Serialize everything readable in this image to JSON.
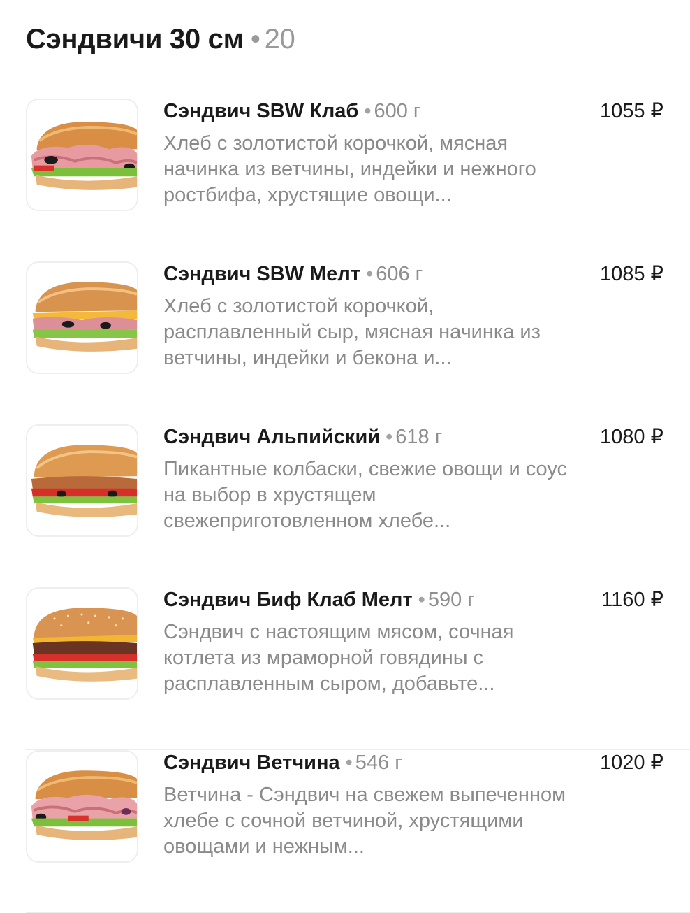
{
  "section": {
    "title": "Сэндвичи 30 см",
    "count": "20"
  },
  "separator": "•",
  "items": [
    {
      "name": "Сэндвич SBW Клаб",
      "weight": "600 г",
      "price": "1055 ₽",
      "description": "Хлеб с золотистой корочкой, мясная начинка из ветчины, индейки и нежного ростбифа, хрустящие овощи...",
      "image": "sandwich-club-image"
    },
    {
      "name": "Сэндвич SBW Мелт",
      "weight": "606 г",
      "price": "1085 ₽",
      "description": "Хлеб с золотистой корочкой, расплавленный сыр, мясная начинка из ветчины, индейки и бекона и...",
      "image": "sandwich-melt-image"
    },
    {
      "name": "Сэндвич Альпийский",
      "weight": "618 г",
      "price": "1080 ₽",
      "description": "Пикантные колбаски, свежие овощи и соус на выбор в хрустящем свежеприготовленном хлебе...",
      "image": "sandwich-alpine-image"
    },
    {
      "name": "Сэндвич Биф Клаб Мелт",
      "weight": "590 г",
      "price": "1160 ₽",
      "description": "Сэндвич с настоящим мясом, сочная котлета из мраморной говядины с расплавленным сыром, добавьте...",
      "image": "sandwich-beef-image"
    },
    {
      "name": "Сэндвич Ветчина",
      "weight": "546 г",
      "price": "1020 ₽",
      "description": "Ветчина - Сэндвич на свежем выпеченном хлебе с сочной ветчиной, хрустящими овощами и нежным...",
      "image": "sandwich-ham-image"
    }
  ]
}
